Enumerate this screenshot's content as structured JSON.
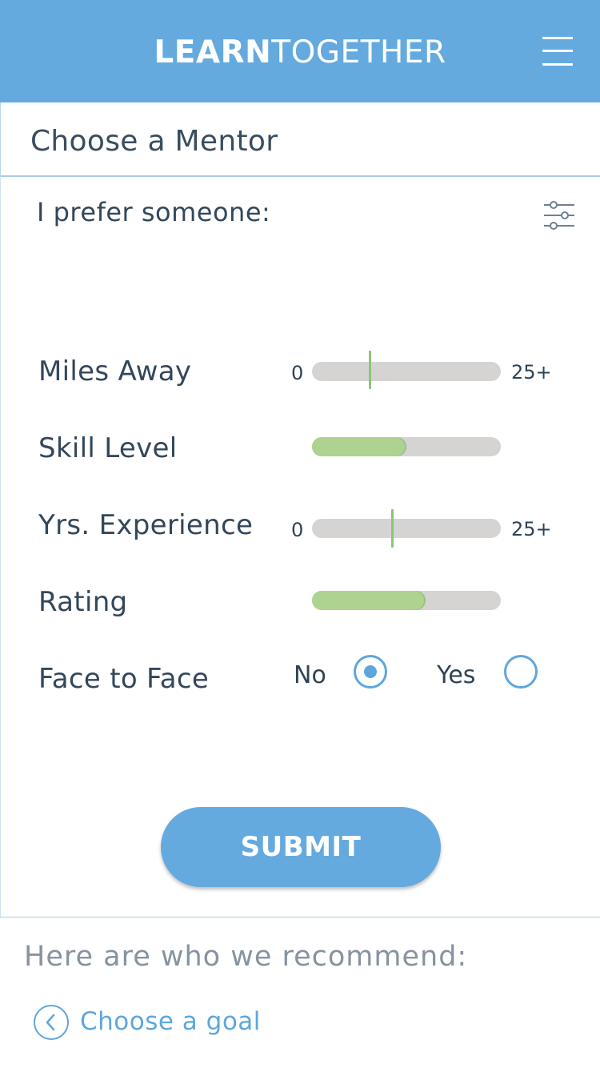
{
  "header": {
    "brand_bold": "LEARN",
    "brand_light": "TOGETHER",
    "menu_icon": "hamburger-menu-icon",
    "background": "#64aadf"
  },
  "page": {
    "title": "Choose a Mentor",
    "prefer_label": "I prefer someone:",
    "filter_icon": "sliders-filter-icon"
  },
  "filters": {
    "miles_away": {
      "label": "Miles Away",
      "min": "0",
      "max": "25+",
      "value_fraction": 0.3
    },
    "skill_level": {
      "label": "Skill Level",
      "value_fraction": 0.5
    },
    "years_experience": {
      "label": "Yrs. Experience",
      "min": "0",
      "max": "25+",
      "value_fraction": 0.42
    },
    "rating": {
      "label": "Rating",
      "value_fraction": 0.6
    },
    "face_to_face": {
      "label": "Face to Face",
      "option_no": "No",
      "option_yes": "Yes",
      "selected": "No"
    }
  },
  "submit_label": "SUBMIT",
  "recommend_label": "Here are who we recommend:",
  "back_link": {
    "label": "Choose a goal",
    "icon": "chevron-left-circle-icon"
  },
  "colors": {
    "accent": "#64aadf",
    "slider_fill": "#aed290",
    "slider_track": "#d5d4d2"
  }
}
